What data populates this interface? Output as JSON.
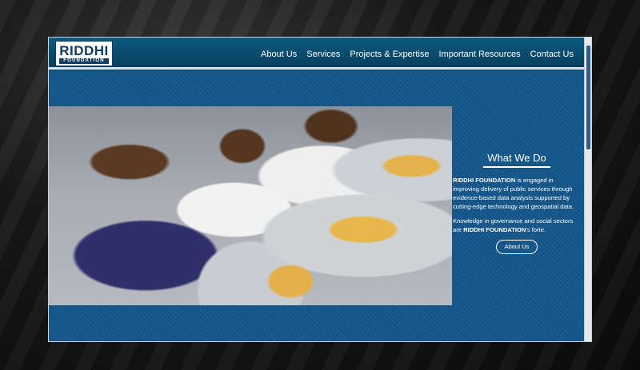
{
  "header": {
    "logo_main": "RIDDHI",
    "logo_sub": "FOUNDATION",
    "nav": [
      "About Us",
      "Services",
      "Projects & Expertise",
      "Important Resources",
      "Contact Us"
    ]
  },
  "hero": {
    "image_alt": "Children sharing a meal from steel plates"
  },
  "side": {
    "title": "What We Do",
    "p1_org": "RIDDHI FOUNDATION",
    "p1_rest": " is engaged in improving delivery of public services through evidence-based data analysis supported by cutting-edge technology and geospatial data.",
    "p2_start": "Knowledge in governance and social sectors are ",
    "p2_org": "RIDDHI FOUNDATION",
    "p2_end": "'s forte.",
    "button": "About Us"
  },
  "colors": {
    "header": "#0b5b7f",
    "panel": "#14568a",
    "text": "#ffffff"
  }
}
